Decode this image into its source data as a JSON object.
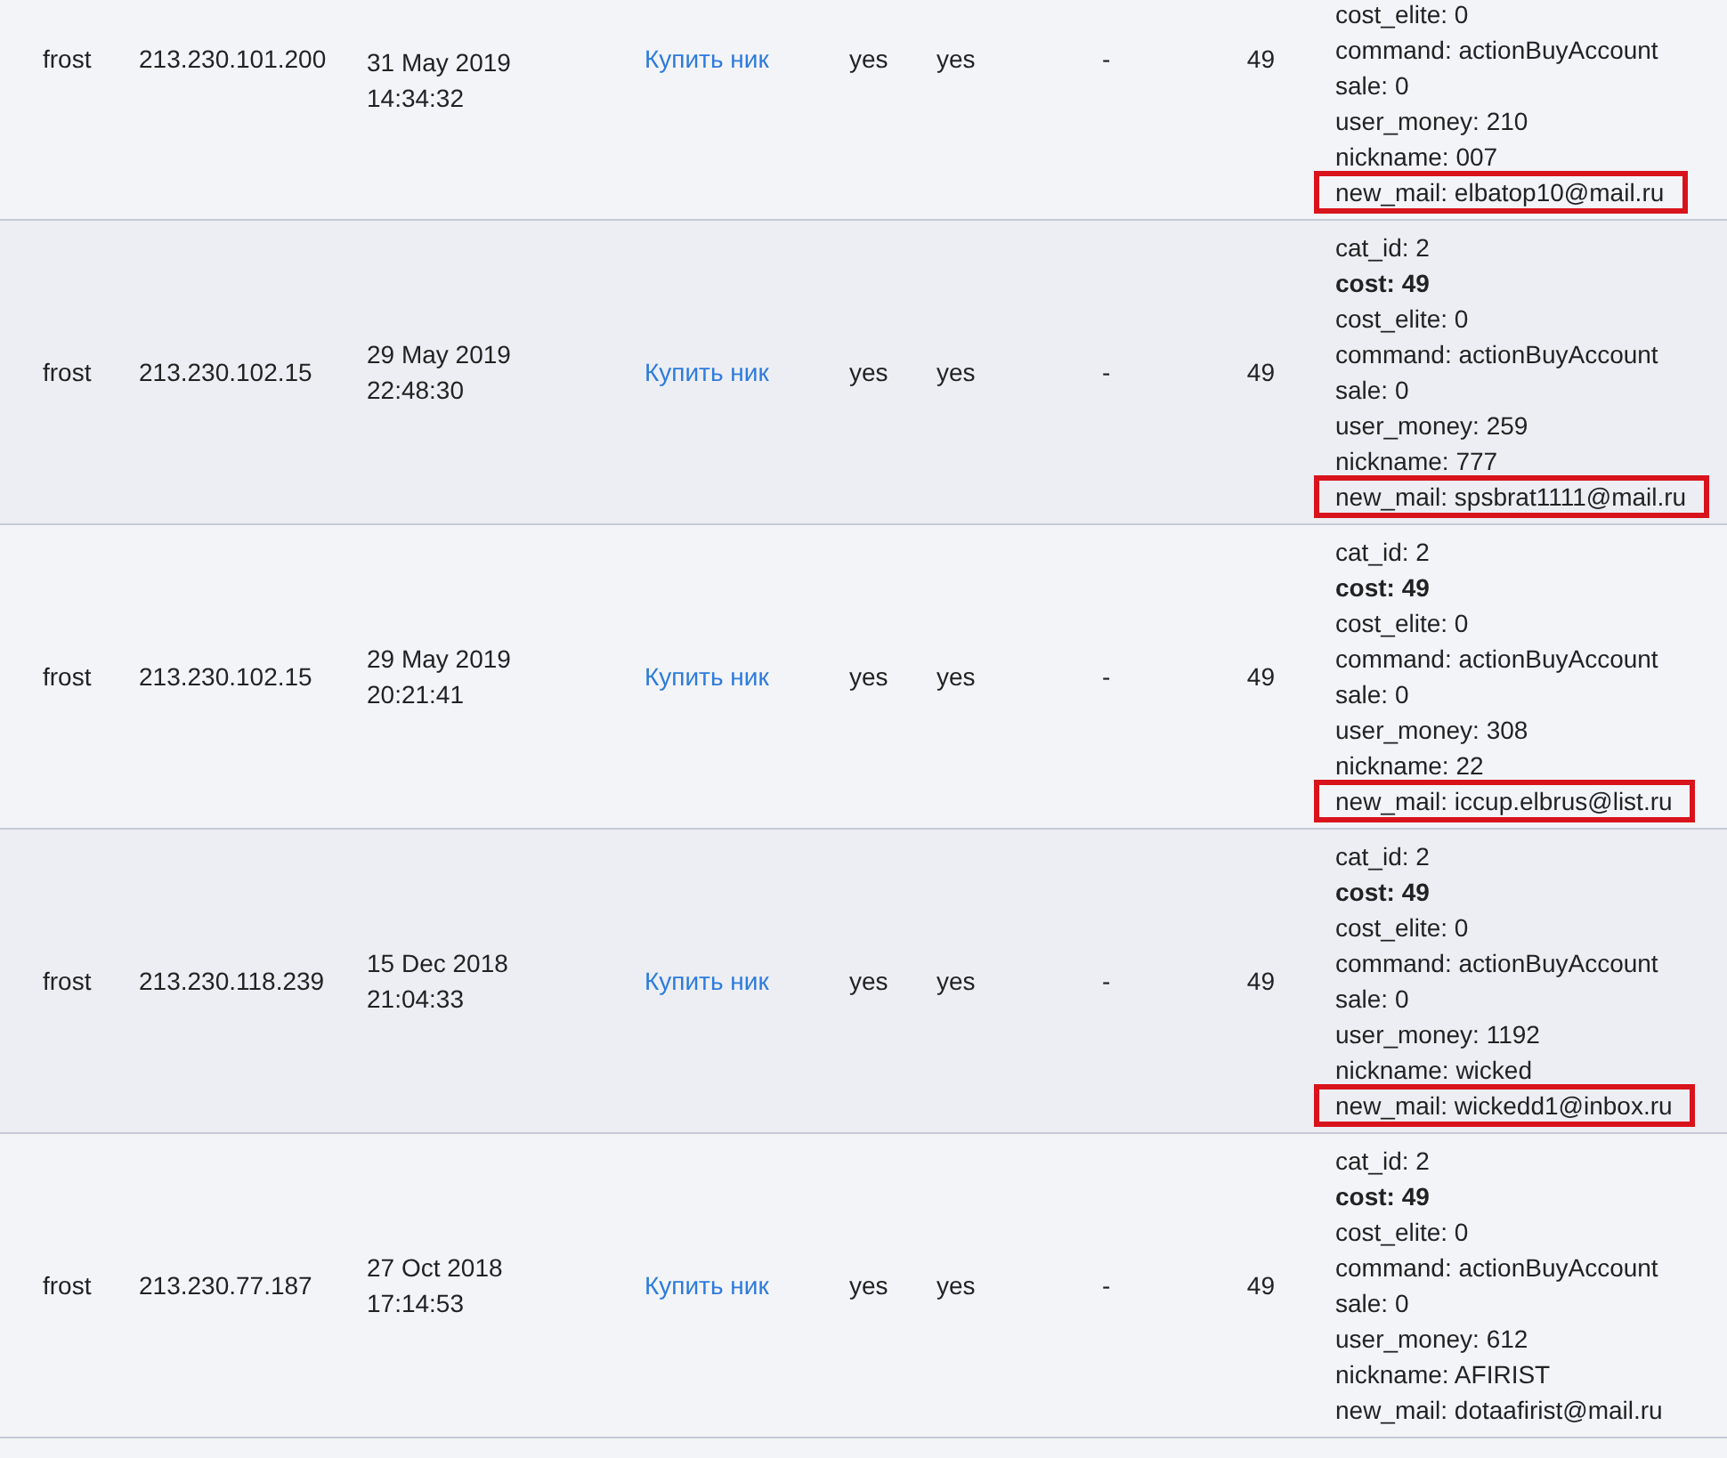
{
  "rows": [
    {
      "user": "frost",
      "ip": "213.230.101.200",
      "date": "31 May 2019",
      "time": "14:34:32",
      "action": "Купить ник",
      "col_5": "yes",
      "col_6": "yes",
      "col_7": "-",
      "amount": "49",
      "details": [
        {
          "text": "cost_elite: 0",
          "bold": false,
          "highlighted": false
        },
        {
          "text": "command: actionBuyAccount",
          "bold": false,
          "highlighted": false
        },
        {
          "text": "sale: 0",
          "bold": false,
          "highlighted": false
        },
        {
          "text": "user_money: 210",
          "bold": false,
          "highlighted": false
        },
        {
          "text": "nickname: 007",
          "bold": false,
          "highlighted": false
        },
        {
          "text": "new_mail: elbatop10@mail.ru",
          "bold": false,
          "highlighted": true
        }
      ]
    },
    {
      "user": "frost",
      "ip": "213.230.102.15",
      "date": "29 May 2019",
      "time": "22:48:30",
      "action": "Купить ник",
      "col_5": "yes",
      "col_6": "yes",
      "col_7": "-",
      "amount": "49",
      "details": [
        {
          "text": "cat_id: 2",
          "bold": false,
          "highlighted": false
        },
        {
          "text": "cost: 49",
          "bold": true,
          "highlighted": false
        },
        {
          "text": "cost_elite: 0",
          "bold": false,
          "highlighted": false
        },
        {
          "text": "command: actionBuyAccount",
          "bold": false,
          "highlighted": false
        },
        {
          "text": "sale: 0",
          "bold": false,
          "highlighted": false
        },
        {
          "text": "user_money: 259",
          "bold": false,
          "highlighted": false
        },
        {
          "text": "nickname: 777",
          "bold": false,
          "highlighted": false
        },
        {
          "text": "new_mail: spsbrat1111@mail.ru",
          "bold": false,
          "highlighted": true
        }
      ]
    },
    {
      "user": "frost",
      "ip": "213.230.102.15",
      "date": "29 May 2019",
      "time": "20:21:41",
      "action": "Купить ник",
      "col_5": "yes",
      "col_6": "yes",
      "col_7": "-",
      "amount": "49",
      "details": [
        {
          "text": "cat_id: 2",
          "bold": false,
          "highlighted": false
        },
        {
          "text": "cost: 49",
          "bold": true,
          "highlighted": false
        },
        {
          "text": "cost_elite: 0",
          "bold": false,
          "highlighted": false
        },
        {
          "text": "command: actionBuyAccount",
          "bold": false,
          "highlighted": false
        },
        {
          "text": "sale: 0",
          "bold": false,
          "highlighted": false
        },
        {
          "text": "user_money: 308",
          "bold": false,
          "highlighted": false
        },
        {
          "text": "nickname: 22",
          "bold": false,
          "highlighted": false
        },
        {
          "text": "new_mail: iccup.elbrus@list.ru",
          "bold": false,
          "highlighted": true
        }
      ]
    },
    {
      "user": "frost",
      "ip": "213.230.118.239",
      "date": "15 Dec 2018",
      "time": "21:04:33",
      "action": "Купить ник",
      "col_5": "yes",
      "col_6": "yes",
      "col_7": "-",
      "amount": "49",
      "details": [
        {
          "text": "cat_id: 2",
          "bold": false,
          "highlighted": false
        },
        {
          "text": "cost: 49",
          "bold": true,
          "highlighted": false
        },
        {
          "text": "cost_elite: 0",
          "bold": false,
          "highlighted": false
        },
        {
          "text": "command: actionBuyAccount",
          "bold": false,
          "highlighted": false
        },
        {
          "text": "sale: 0",
          "bold": false,
          "highlighted": false
        },
        {
          "text": "user_money: 1192",
          "bold": false,
          "highlighted": false
        },
        {
          "text": "nickname: wicked",
          "bold": false,
          "highlighted": false
        },
        {
          "text": "new_mail: wickedd1@inbox.ru",
          "bold": false,
          "highlighted": true
        }
      ]
    },
    {
      "user": "frost",
      "ip": "213.230.77.187",
      "date": "27 Oct 2018",
      "time": "17:14:53",
      "action": "Купить ник",
      "col_5": "yes",
      "col_6": "yes",
      "col_7": "-",
      "amount": "49",
      "details": [
        {
          "text": "cat_id: 2",
          "bold": false,
          "highlighted": false
        },
        {
          "text": "cost: 49",
          "bold": true,
          "highlighted": false
        },
        {
          "text": "cost_elite: 0",
          "bold": false,
          "highlighted": false
        },
        {
          "text": "command: actionBuyAccount",
          "bold": false,
          "highlighted": false
        },
        {
          "text": "sale: 0",
          "bold": false,
          "highlighted": false
        },
        {
          "text": "user_money: 612",
          "bold": false,
          "highlighted": false
        },
        {
          "text": "nickname: AFIRIST",
          "bold": false,
          "highlighted": false
        },
        {
          "text": "new_mail: dotaafirist@mail.ru",
          "bold": false,
          "highlighted": false
        }
      ]
    }
  ]
}
